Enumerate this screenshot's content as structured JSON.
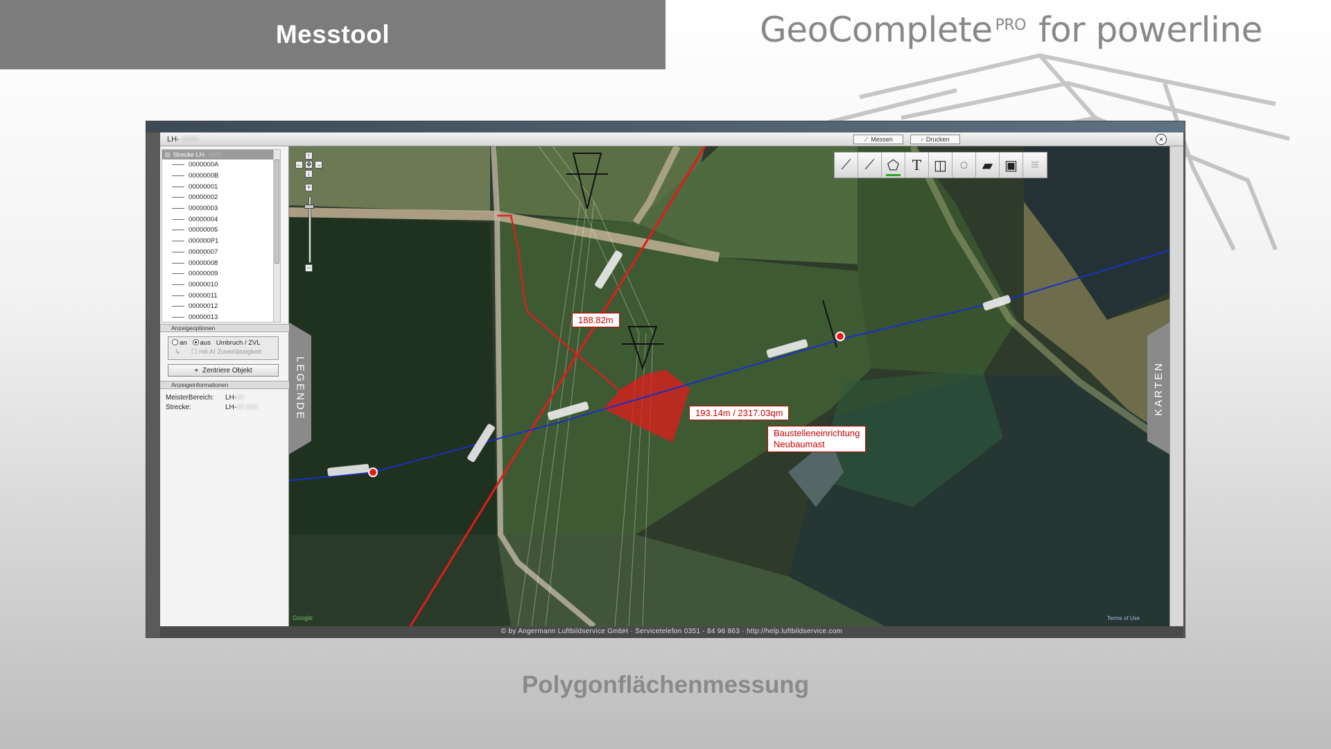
{
  "banner": {
    "title": "Messtool"
  },
  "product": {
    "name": "GeoComplete",
    "superscript": "PRO",
    "suffix": "for powerline"
  },
  "caption": "Polygonflächenmessung",
  "window": {
    "title": "LH-",
    "buttons": {
      "measure": "Messen",
      "print": "Drucken"
    }
  },
  "sidebar": {
    "root": "Strecke LH-",
    "items": [
      "0000000A",
      "0000000B",
      "00000001",
      "00000002",
      "00000003",
      "00000004",
      "00000005",
      "000000P1",
      "00000007",
      "00000008",
      "00000009",
      "00000010",
      "00000011",
      "00000012",
      "00000013"
    ],
    "options_header": "Anzeigeoptionen",
    "radio_on": "an",
    "radio_off": "aus",
    "radio_label": "Umbruch / ZVL",
    "checkbox_label": "mit AI Zuverlässigkeit",
    "center_button": "Zentriere Objekt",
    "info_header": "Anzeigeinformationen",
    "info_meister_label": "MeisterBereich:",
    "info_meister_value": "LH-",
    "info_strecke_label": "Strecke:",
    "info_strecke_value": "LH-"
  },
  "map": {
    "label_distance": "188.82m",
    "label_area": "193.14m / 2317.03qm",
    "label_note_line1": "Baustelleneinrichtung",
    "label_note_line2": "Neubaumast",
    "tab_left": "LEGENDE",
    "tab_right": "KARTEN",
    "line_tag": "LH-",
    "google": "Google",
    "terms": "Terms of Use"
  },
  "toolbar": {
    "tools": [
      "line-tool-icon",
      "polyline-tool-icon",
      "polygon-tool-icon",
      "text-tool-icon",
      "screenshot-tool-icon",
      "circle-tool-icon",
      "eraser-tool-icon",
      "save-tool-icon",
      "list-tool-icon"
    ]
  },
  "footer": "©  by Angermann Luftbildservice GmbH   ·   Servicetelefon 0351 - 84 96 863   ·   http://help.luftbildservice.com"
}
